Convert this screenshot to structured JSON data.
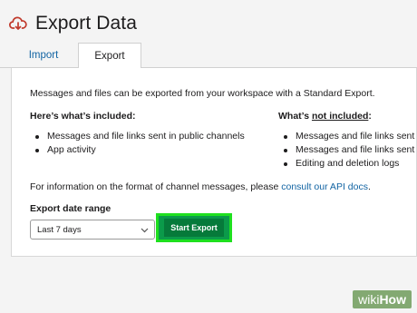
{
  "header": {
    "title": "Export Data",
    "icon": "cloud-download-icon"
  },
  "tabs": [
    {
      "label": "Import"
    },
    {
      "label": "Export"
    }
  ],
  "intro": "Messages and files can be exported from your workspace with a Standard Export.",
  "included": {
    "title": "Here’s what’s included:",
    "items": [
      "Messages and file links sent in public channels",
      "App activity"
    ]
  },
  "not_included": {
    "title_prefix": "What’s ",
    "title_ul": "not included",
    "title_suffix": ":",
    "items": [
      "Messages and file links sent",
      "Messages and file links sent",
      "Editing and deletion logs"
    ]
  },
  "info": {
    "text": "For information on the format of channel messages, please ",
    "link": "consult our API docs",
    "suffix": "."
  },
  "range": {
    "label": "Export date range",
    "selected": "Last 7 days"
  },
  "button": {
    "label": "Start Export"
  },
  "watermark": {
    "prefix": "wiki",
    "suffix": "How"
  },
  "colors": {
    "link": "#1264a3",
    "button": "#067a3a",
    "highlight": "#1fe01f",
    "icon": "#e01e5a"
  }
}
